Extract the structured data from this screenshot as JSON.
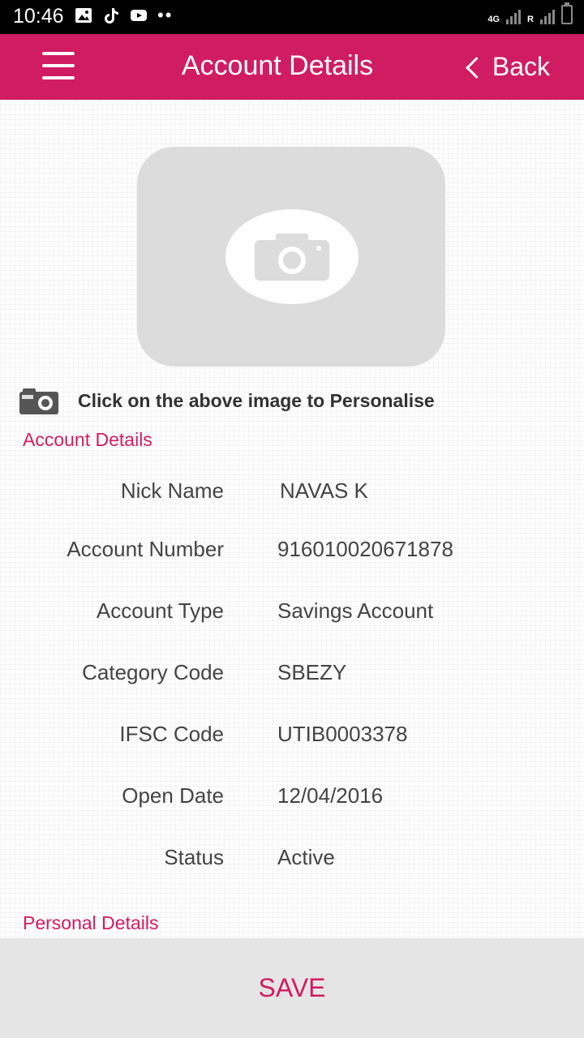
{
  "status_bar": {
    "time": "10:46",
    "network": "4G",
    "roaming": "R",
    "icons": [
      "image-icon",
      "tiktok-icon",
      "youtube-icon",
      "more-dots-icon",
      "signal-icon",
      "battery-icon"
    ]
  },
  "app_bar": {
    "title": "Account Details",
    "back_label": "Back"
  },
  "photo": {
    "hint": "Click on the above image to Personalise"
  },
  "account_section": {
    "title": "Account Details",
    "rows": [
      {
        "label": "Nick Name",
        "value": "NAVAS K"
      },
      {
        "label": "Account Number",
        "value": "916010020671878"
      },
      {
        "label": "Account Type",
        "value": "Savings Account"
      },
      {
        "label": "Category Code",
        "value": "SBEZY"
      },
      {
        "label": "IFSC Code",
        "value": "UTIB0003378"
      },
      {
        "label": "Open Date",
        "value": "12/04/2016"
      },
      {
        "label": "Status",
        "value": "Active"
      }
    ]
  },
  "next_section": {
    "title": "Personal Details"
  },
  "footer": {
    "save_label": "SAVE"
  },
  "colors": {
    "brand": "#d01c63",
    "footer_bg": "#e5e5e5",
    "photo_bg": "#dcdcdc"
  }
}
